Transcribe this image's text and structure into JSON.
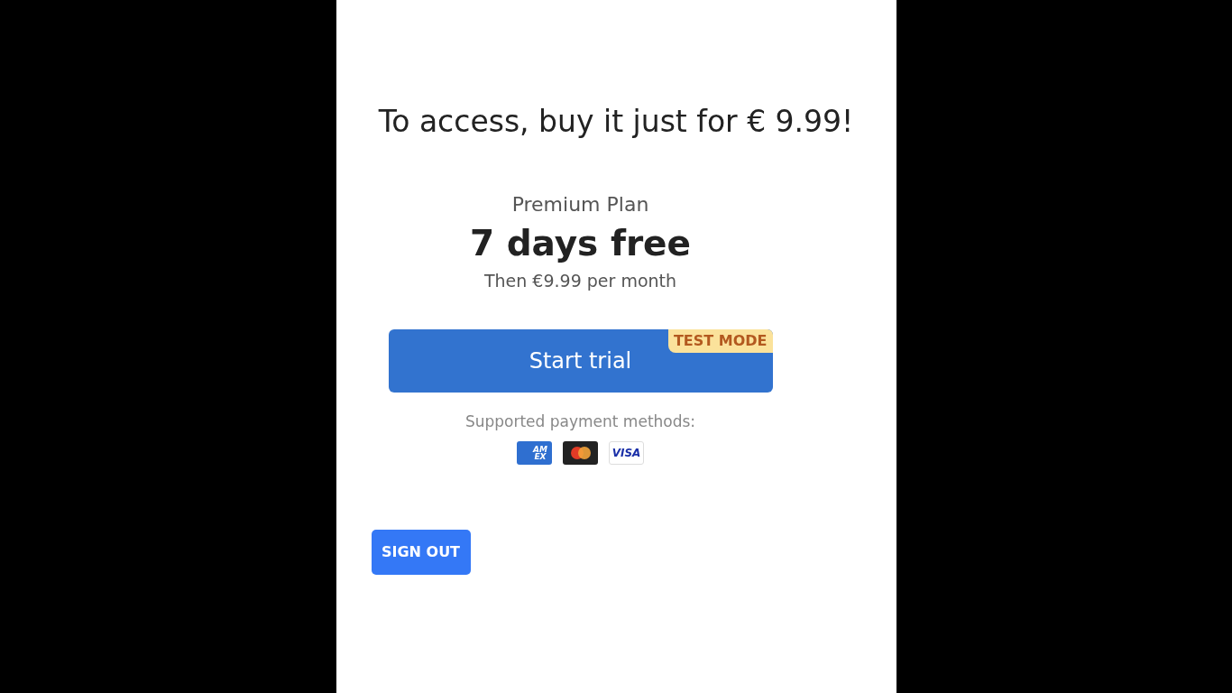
{
  "title": "To access, buy it just for € 9.99!",
  "plan": {
    "name": "Premium Plan",
    "headline": "7 days free",
    "subtitle": "Then €9.99 per month"
  },
  "trial_button": {
    "label": "Start trial",
    "badge": "TEST MODE"
  },
  "payment": {
    "label": "Supported payment methods:",
    "methods": [
      {
        "kind": "amex",
        "text": "AM EX"
      },
      {
        "kind": "mastercard"
      },
      {
        "kind": "visa",
        "text": "VISA"
      }
    ]
  },
  "sign_out": {
    "label": "SIGN OUT"
  }
}
